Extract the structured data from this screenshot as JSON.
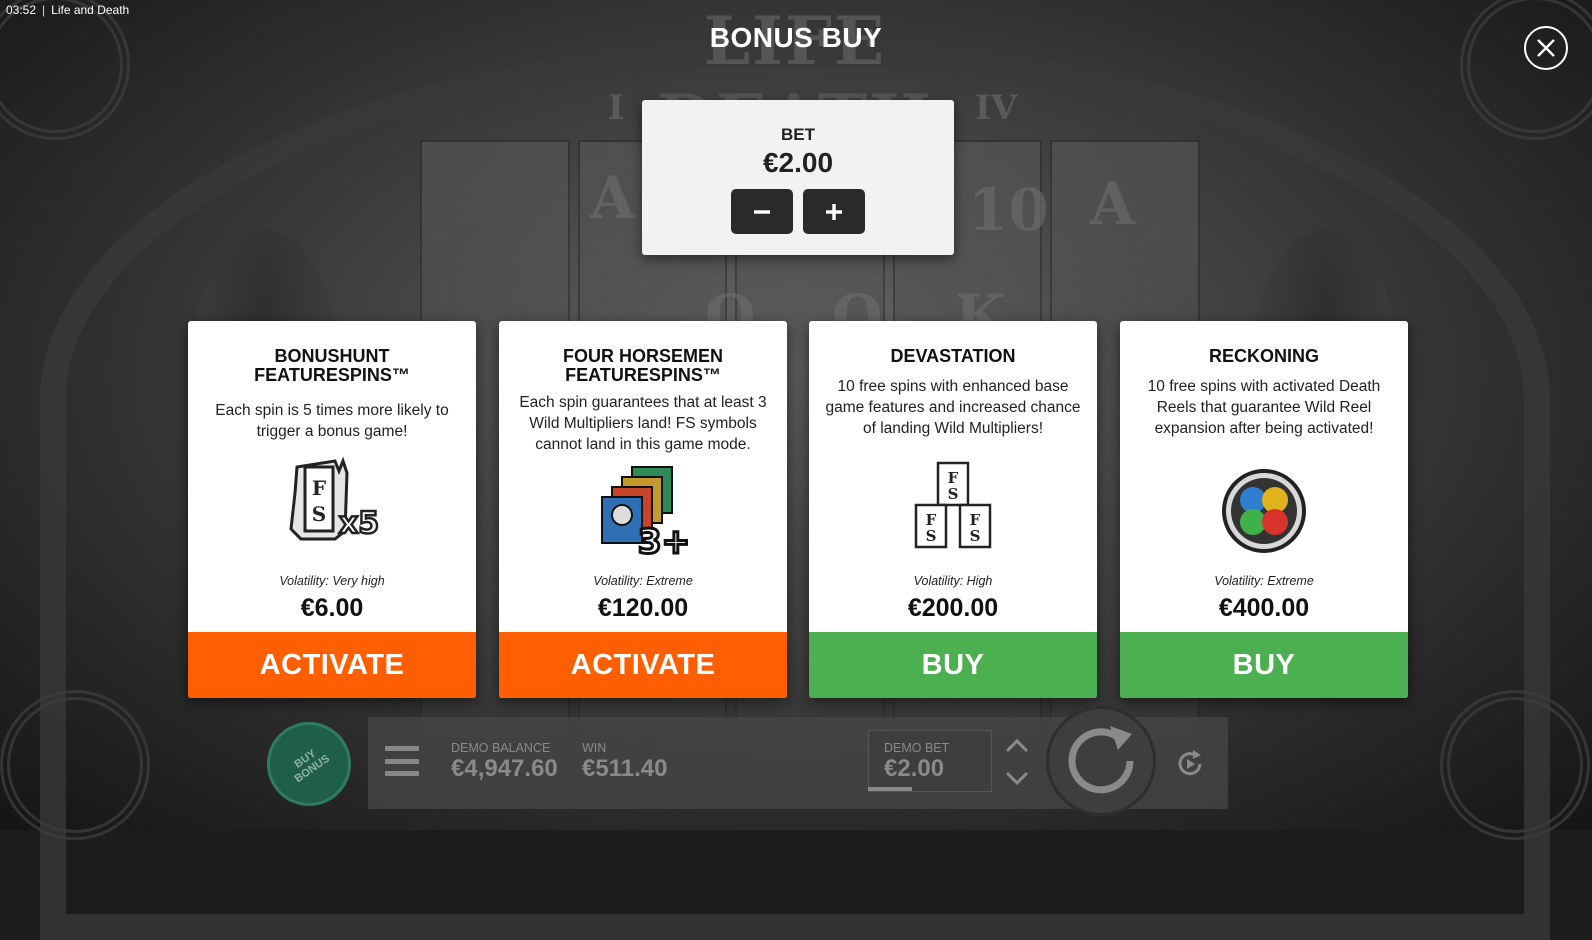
{
  "status": {
    "time": "03:52",
    "separator": "|",
    "app_title": "Life and Death"
  },
  "background": {
    "logo_text": "LIFE DEATH",
    "roman_left": "I",
    "roman_right": "IV",
    "reel_letters": [
      "A",
      "10",
      "A",
      "Q",
      "Q",
      "K"
    ]
  },
  "overlay": {
    "title": "BONUS BUY",
    "close_icon": "close-icon"
  },
  "bet": {
    "label": "BET",
    "value": "€2.00",
    "minus_icon": "minus-icon",
    "plus_icon": "plus-icon"
  },
  "cards": [
    {
      "title": "BONUSHUNT FEATURESPINS™",
      "description": "Each spin is 5 times more likely to trigger a bonus game!",
      "icon": "fs-x5-icon",
      "icon_text": "x5",
      "volatility": "Volatility: Very high",
      "price": "€6.00",
      "button_label": "ACTIVATE",
      "button_color": "#ff5f00"
    },
    {
      "title": "FOUR HORSEMEN FEATURESPINS™",
      "description": "Each spin guarantees that at least 3 Wild Multipliers land! FS symbols cannot land in this game mode.",
      "icon": "horsemen-cards-3plus-icon",
      "icon_text": "3+",
      "volatility": "Volatility: Extreme",
      "price": "€120.00",
      "button_label": "ACTIVATE",
      "button_color": "#ff5f00"
    },
    {
      "title": "DEVASTATION",
      "description": "10 free spins with enhanced base game features and increased chance of landing Wild Multipliers!",
      "icon": "fs-stack-icon",
      "volatility": "Volatility: High",
      "price": "€200.00",
      "button_label": "BUY",
      "button_color": "#4caf50"
    },
    {
      "title": "RECKONING",
      "description": "10 free spins with activated Death Reels that guarantee Wild Reel expansion after being activated!",
      "icon": "four-gems-icon",
      "volatility": "Volatility: Extreme",
      "price": "€400.00",
      "button_label": "BUY",
      "button_color": "#4caf50"
    }
  ],
  "bottom_bar": {
    "buy_bonus_label": "BUY\nBONUS",
    "menu_icon": "hamburger-menu-icon",
    "demo_balance_label": "DEMO BALANCE",
    "demo_balance_value": "€4,947.60",
    "win_label": "WIN",
    "win_value": "€511.40",
    "demo_bet_label": "DEMO BET",
    "demo_bet_value": "€2.00",
    "spin_icon": "spin-icon",
    "autoplay_icon": "autoplay-icon"
  }
}
